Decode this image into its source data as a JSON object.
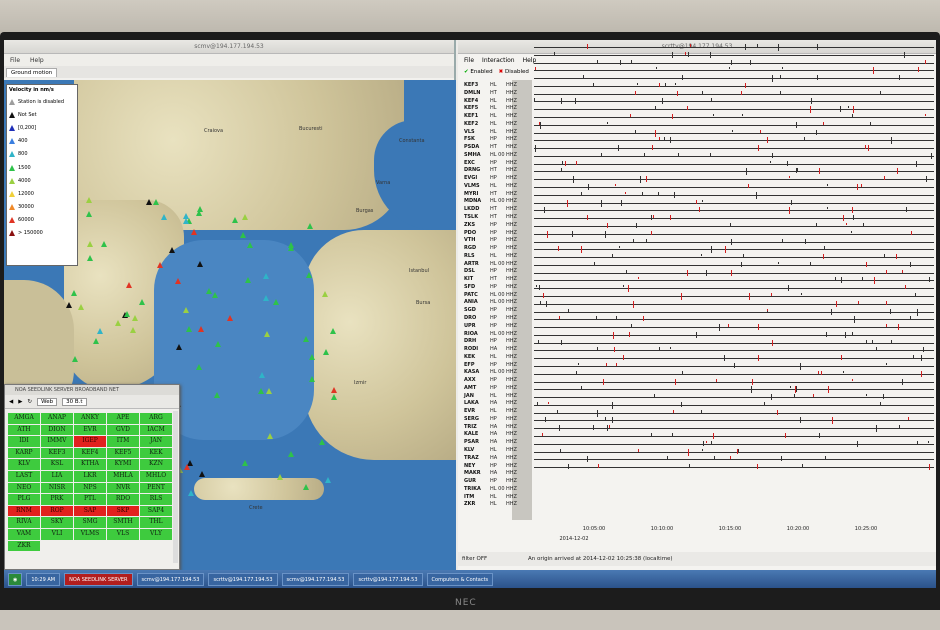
{
  "left_window": {
    "menu": [
      "File",
      "Help"
    ],
    "tab_label": "Ground motion",
    "map_labels": [
      "Bucuresti",
      "Craiova",
      "Constanta",
      "Varna",
      "Burgas",
      "Istanbul",
      "Bursa",
      "Izmir",
      "Crete"
    ],
    "legend": {
      "title": "Velocity in nm/s",
      "items": [
        {
          "label": "Station is disabled",
          "color": "#9e9e9e"
        },
        {
          "label": "Not Set",
          "color": "#111111"
        },
        {
          "label": "[0,200]",
          "color": "#1f2fb8"
        },
        {
          "label": "400",
          "color": "#3a7fe0"
        },
        {
          "label": "800",
          "color": "#2fb4c8"
        },
        {
          "label": "1500",
          "color": "#2ec24a"
        },
        {
          "label": "4000",
          "color": "#9ad042"
        },
        {
          "label": "12000",
          "color": "#f0d03a"
        },
        {
          "label": "30000",
          "color": "#f08a2a"
        },
        {
          "label": "60000",
          "color": "#e03424"
        },
        {
          "label": "> 150000",
          "color": "#8a1010"
        }
      ]
    }
  },
  "popup": {
    "title": "NOA SEEDLINK SERVER BROADBAND NET",
    "web_label": "Web",
    "zoom": "30 B.t",
    "stations": [
      "AMGA",
      "ANAP",
      "ANKY",
      "APE",
      "ARG",
      "ATH",
      "DION",
      "EVR",
      "GVD",
      "IACM",
      "IDI",
      "IMMV",
      "IGEP",
      "ITM",
      "JAN",
      "KARP",
      "KEF3",
      "KEF4",
      "KEF5",
      "KEK",
      "KLV",
      "KSL",
      "KTHA",
      "KYMI",
      "KZN",
      "LAST",
      "LIA",
      "LKR",
      "MHLA",
      "MHLO",
      "NEO",
      "NISR",
      "NPS",
      "NVR",
      "PENT",
      "PLG",
      "PRK",
      "PTL",
      "RDO",
      "RLS",
      "RNM",
      "ROP",
      "SAP",
      "SKP",
      "SAP4",
      "RIVA",
      "SKY",
      "SMG",
      "SMTH",
      "THL",
      "VAM",
      "VLI",
      "VLMS",
      "VLS",
      "VLY",
      "ZKR"
    ],
    "red_stations": [
      "IGEP",
      "RNM",
      "ROP",
      "SAP",
      "SKP"
    ]
  },
  "right_window": {
    "menu": [
      "File",
      "Interaction",
      "Help"
    ],
    "tab_enabled": "Enabled",
    "tab_disabled": "Disabled",
    "channel": "HHZ",
    "rows": [
      [
        "KEF3",
        "HL"
      ],
      [
        "DMLN",
        "HT"
      ],
      [
        "KEF4",
        "HL"
      ],
      [
        "KEF5",
        "HL"
      ],
      [
        "KEF1",
        "HL"
      ],
      [
        "KEF2",
        "HL"
      ],
      [
        "VLS",
        "HL"
      ],
      [
        "FSK",
        "HP"
      ],
      [
        "PSDA",
        "HT"
      ],
      [
        "SMHA",
        "HL 00"
      ],
      [
        "EXC",
        "HP"
      ],
      [
        "DRNG",
        "HT"
      ],
      [
        "EVGI",
        "HP"
      ],
      [
        "VLMS",
        "HL"
      ],
      [
        "MYRI",
        "HT"
      ],
      [
        "MDNA",
        "HL 00"
      ],
      [
        "LKDD",
        "HT"
      ],
      [
        "TSLK",
        "HT"
      ],
      [
        "ZKS",
        "HP"
      ],
      [
        "PDO",
        "HP"
      ],
      [
        "VTH",
        "HP"
      ],
      [
        "RGD",
        "HP"
      ],
      [
        "RLS",
        "HL"
      ],
      [
        "ARTR",
        "HL 00"
      ],
      [
        "DSL",
        "HP"
      ],
      [
        "KIT",
        "HT"
      ],
      [
        "SFD",
        "HP"
      ],
      [
        "PATC",
        "HL 00"
      ],
      [
        "ANIA",
        "HL 00"
      ],
      [
        "SGD",
        "HP"
      ],
      [
        "DRO",
        "HP"
      ],
      [
        "UPR",
        "HP"
      ],
      [
        "RIOA",
        "HL 00"
      ],
      [
        "DRH",
        "HP"
      ],
      [
        "RODI",
        "HA"
      ],
      [
        "KEK",
        "HL"
      ],
      [
        "EFP",
        "HP"
      ],
      [
        "KASA",
        "HL 00"
      ],
      [
        "AXX",
        "HP"
      ],
      [
        "AMT",
        "HP"
      ],
      [
        "JAN",
        "HL"
      ],
      [
        "LAKA",
        "HA"
      ],
      [
        "EVR",
        "HL"
      ],
      [
        "SERG",
        "HP"
      ],
      [
        "TRIZ",
        "HA"
      ],
      [
        "KALE",
        "HA"
      ],
      [
        "PSAR",
        "HA"
      ],
      [
        "KLV",
        "HL"
      ],
      [
        "TRAZ",
        "HA"
      ],
      [
        "NEY",
        "HP"
      ],
      [
        "MAKR",
        "HA"
      ],
      [
        "GUR",
        "HP"
      ],
      [
        "TRIKA",
        "HL 00"
      ],
      [
        "ITM",
        "HL"
      ],
      [
        "ZKR",
        "HL"
      ]
    ],
    "time_ticks": [
      "10:05:00",
      "10:10:00",
      "10:15:00",
      "10:20:00",
      "10:25:00"
    ],
    "date_label": "2014-12-02",
    "status": "An origin arrived at 2014-12-02 10:25:38 (localtime)",
    "filter_label": "filter OFF"
  },
  "taskbar": {
    "time": "10:29 AM",
    "items": [
      "NOA SEEDLINK SERVER",
      "scmv@194.177.194.53",
      "scrttv@194.177.194.53",
      "scmv@194.177.194.53",
      "scrttv@194.177.194.53",
      "Computers & Contacts"
    ]
  }
}
